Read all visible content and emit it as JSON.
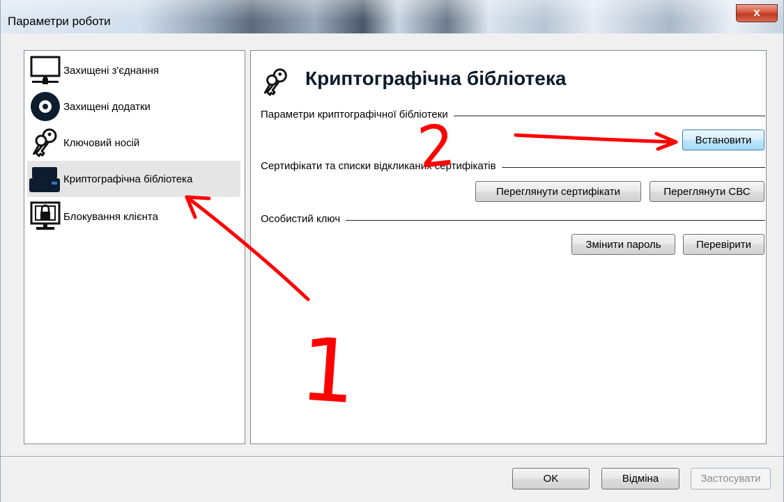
{
  "window": {
    "title": "Параметри роботи",
    "close_label": "x"
  },
  "sidebar": {
    "items": [
      {
        "label": "Захищені з'єднання",
        "icon": "monitor-network-icon",
        "selected": false
      },
      {
        "label": "Захищені додатки",
        "icon": "disc-icon",
        "selected": false
      },
      {
        "label": "Ключовий носій",
        "icon": "keys-icon",
        "selected": false
      },
      {
        "label": "Криптографічна бібліотека",
        "icon": "usb-drive-icon",
        "selected": true
      },
      {
        "label": "Блокування клієнта",
        "icon": "lock-screen-icon",
        "selected": false
      }
    ]
  },
  "main": {
    "title": "Криптографічна бібліотека",
    "title_icon": "keys-icon",
    "groups": {
      "crypto_params": {
        "label": "Параметри криптографічної бібліотеки",
        "install_button": "Встановити"
      },
      "certificates": {
        "label": "Сертифікати та списки відкликаних сертифікатів",
        "view_certs_button": "Переглянути сертифікати",
        "view_crl_button": "Переглянути СВС"
      },
      "private_key": {
        "label": "Особистий ключ",
        "change_password_button": "Змінити пароль",
        "verify_button": "Перевірити"
      }
    }
  },
  "footer": {
    "ok_button": "OK",
    "cancel_button": "Відміна",
    "apply_button": "Застосувати"
  },
  "annotations": {
    "step1": "1",
    "step2": "2",
    "color": "#ff0000"
  }
}
